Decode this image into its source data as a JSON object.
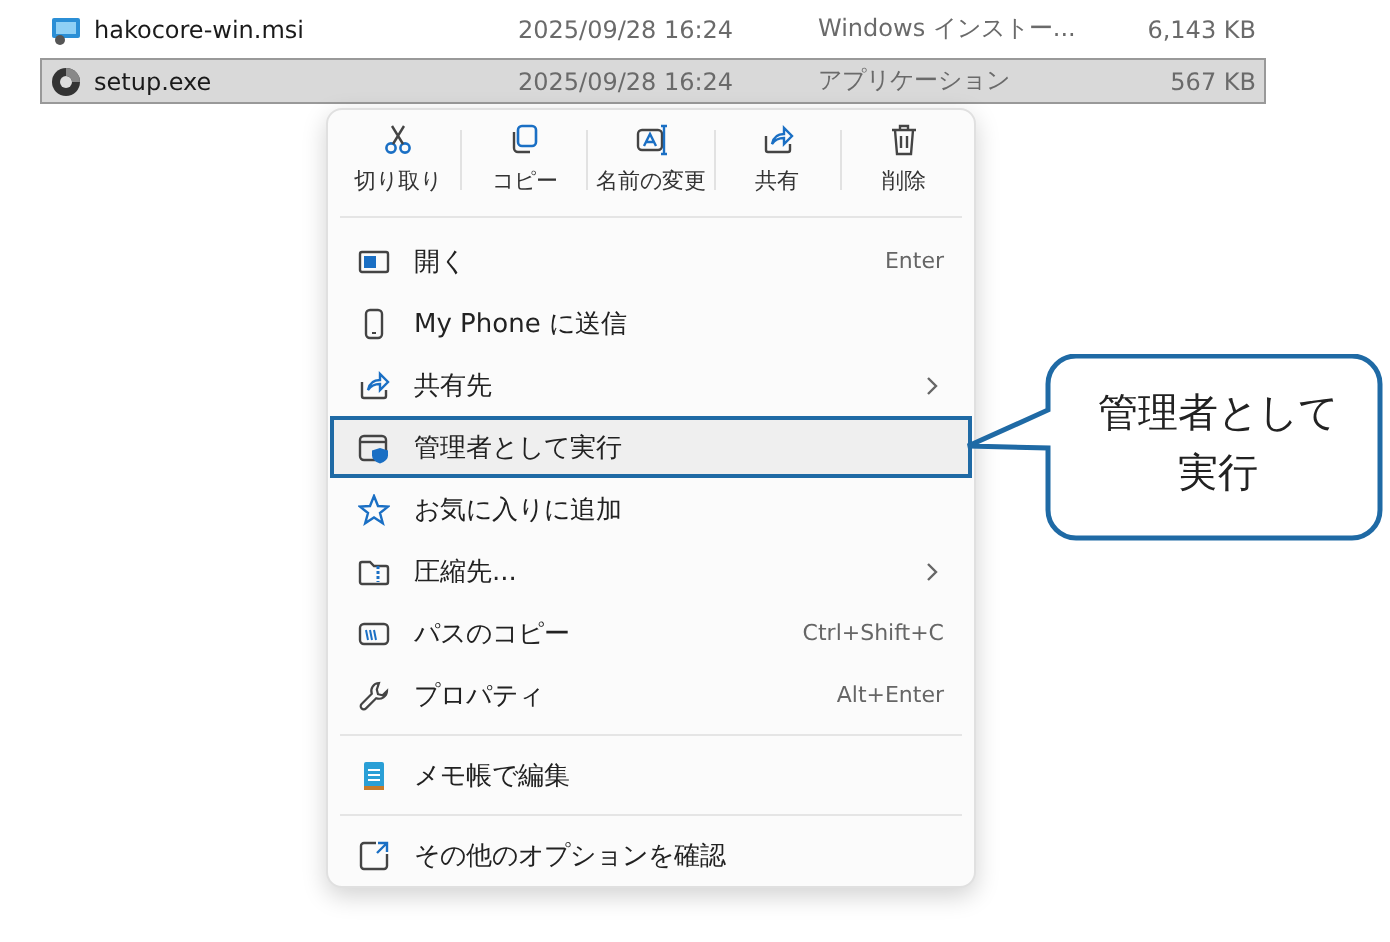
{
  "files": [
    {
      "name": "hakocore-win.msi",
      "date": "2025/09/28 16:24",
      "type": "Windows インストー...",
      "size": "6,143 KB",
      "selected": false,
      "kind": "installer"
    },
    {
      "name": "setup.exe",
      "date": "2025/09/28 16:24",
      "type": "アプリケーション",
      "size": "567 KB",
      "selected": true,
      "kind": "program"
    }
  ],
  "context_menu": {
    "toolbar": [
      {
        "label": "切り取り",
        "kind": "cut"
      },
      {
        "label": "コピー",
        "kind": "copy"
      },
      {
        "label": "名前の変更",
        "kind": "rename"
      },
      {
        "label": "共有",
        "kind": "share"
      },
      {
        "label": "削除",
        "kind": "delete"
      }
    ],
    "items": [
      {
        "kind": "item",
        "label": "開く",
        "shortcut": "Enter",
        "submenu": false,
        "highlighted": false
      },
      {
        "kind": "item",
        "label": "My Phone に送信",
        "submenu": false,
        "highlighted": false
      },
      {
        "kind": "item",
        "label": "共有先",
        "submenu": true,
        "highlighted": false
      },
      {
        "kind": "item",
        "label": "管理者として実行",
        "submenu": false,
        "highlighted": true
      },
      {
        "kind": "item",
        "label": "お気に入りに追加",
        "submenu": false,
        "highlighted": false
      },
      {
        "kind": "item",
        "label": "圧縮先...",
        "submenu": true,
        "highlighted": false
      },
      {
        "kind": "item",
        "label": "パスのコピー",
        "shortcut": "Ctrl+Shift+C",
        "submenu": false,
        "highlighted": false
      },
      {
        "kind": "item",
        "label": "プロパティ",
        "shortcut": "Alt+Enter",
        "submenu": false,
        "highlighted": false
      },
      {
        "kind": "separator"
      },
      {
        "kind": "item",
        "label": "メモ帳で編集",
        "submenu": false,
        "highlighted": false
      },
      {
        "kind": "separator"
      },
      {
        "kind": "item",
        "label": "その他のオプションを確認",
        "submenu": false,
        "highlighted": false
      }
    ]
  },
  "callout": {
    "text": "管理者として実行"
  }
}
